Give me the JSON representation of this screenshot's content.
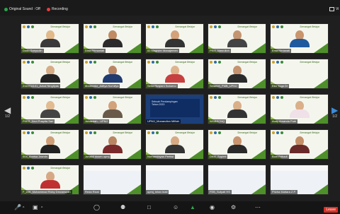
{
  "topbar": {
    "original_sound": "Original Sound : Off",
    "recording": "Recording",
    "view": "Vi"
  },
  "nav": {
    "left_page": "1/2",
    "right_page": "1/2"
  },
  "participants": [
    {
      "name": "Dodo Saepudin"
    },
    {
      "name": "Dina Primaniati"
    },
    {
      "name": "02 Magister Manajemen"
    },
    {
      "name": "PEM_Nasrulloh"
    },
    {
      "name": "Ema Herawati"
    },
    {
      "name": "2110711101_Azkal Ningtiyas"
    },
    {
      "name": "Moderator_Aditya Nur'afya"
    },
    {
      "name": "Setia Rizqiani Subarno"
    },
    {
      "name": "Selamet_PMB_UPMJ"
    },
    {
      "name": "Eko Yoga Dr"
    },
    {
      "name": "FKES_Devi Puspita Sari"
    },
    {
      "name": "Jubaedah - UPMJ"
    },
    {
      "name": "UPMJ_Munandion Miftah"
    },
    {
      "name": "WGBSCNQ"
    },
    {
      "name": "Audy Amanda Putri"
    },
    {
      "name": "004_Annisa Jasmin"
    },
    {
      "name": "Junaidi dosen upmj"
    },
    {
      "name": "Nurhandayan Pertiwi"
    },
    {
      "name": "DKM_Supimi"
    },
    {
      "name": "Boni Pribadi"
    },
    {
      "name": "F_226_Muhammad Rizky Dewansyah"
    },
    {
      "name": "Reda Rizal"
    },
    {
      "name": "upmj_Intan Inati"
    },
    {
      "name": "FEB_Sufyati HS"
    },
    {
      "name": "Prizha Mutiara Z.P."
    }
  ],
  "banner_title": "Semangat Belajar",
  "screen_share": {
    "line1": "Sebuah Pendampingan",
    "line2": "Tahun 2023"
  },
  "bottombar": {
    "leave": "Leave"
  }
}
